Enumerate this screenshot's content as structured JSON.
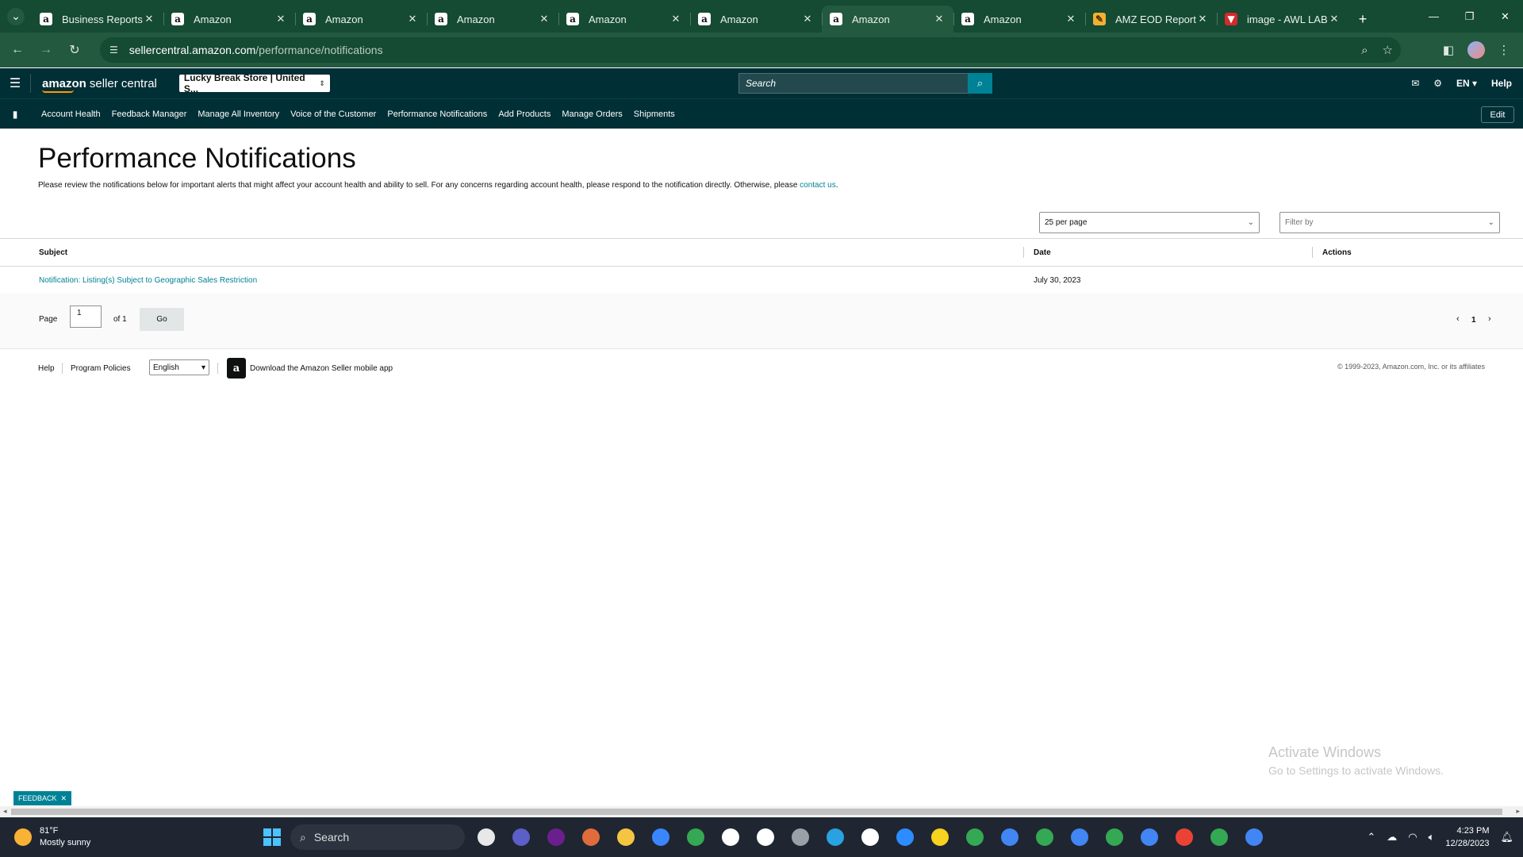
{
  "browser": {
    "tabs": [
      {
        "label": "Business Reports",
        "fav": "a"
      },
      {
        "label": "Amazon",
        "fav": "a"
      },
      {
        "label": "Amazon",
        "fav": "a"
      },
      {
        "label": "Amazon",
        "fav": "a"
      },
      {
        "label": "Amazon",
        "fav": "a"
      },
      {
        "label": "Amazon",
        "fav": "a"
      },
      {
        "label": "Amazon",
        "fav": "a",
        "active": true
      },
      {
        "label": "Amazon",
        "fav": "a"
      },
      {
        "label": "AMZ EOD Report",
        "fav": "eod"
      },
      {
        "label": "image - AWL LAB",
        "fav": "img"
      }
    ],
    "url_host": "sellercentral.amazon.com",
    "url_path": "/performance/notifications"
  },
  "header": {
    "logo_bold": "amazon",
    "logo_text": "seller central",
    "store": "Lucky Break Store | United S...",
    "search_placeholder": "Search",
    "lang": "EN",
    "help": "Help"
  },
  "nav": {
    "items": [
      "Account Health",
      "Feedback Manager",
      "Manage All Inventory",
      "Voice of the Customer",
      "Performance Notifications",
      "Add Products",
      "Manage Orders",
      "Shipments"
    ],
    "edit": "Edit"
  },
  "main": {
    "title": "Performance Notifications",
    "intro": "Please review the notifications below for important alerts that might affect your account health and ability to sell. For any concerns regarding account health, please respond to the notification directly. Otherwise, please ",
    "intro_link": "contact us",
    "intro_end": ".",
    "per_page": "25 per page",
    "filter": "Filter by",
    "columns": {
      "subject": "Subject",
      "date": "Date",
      "actions": "Actions"
    },
    "rows": [
      {
        "subject": "Notification: Listing(s) Subject to Geographic Sales Restriction",
        "date": "July 30, 2023"
      }
    ],
    "pager": {
      "page_label": "Page",
      "page_value": "1",
      "of": "of 1",
      "go": "Go",
      "current": "1"
    }
  },
  "footer": {
    "help": "Help",
    "policies": "Program Policies",
    "language": "English",
    "download": "Download the Amazon Seller mobile app",
    "copyright": "© 1999-2023, Amazon.com, Inc. or its affiliates"
  },
  "watermark": {
    "line1": "Activate Windows",
    "line2": "Go to Settings to activate Windows."
  },
  "feedback": "FEEDBACK",
  "taskbar": {
    "temp": "81°F",
    "weather": "Mostly sunny",
    "search": "Search",
    "time": "4:23 PM",
    "date": "12/28/2023"
  }
}
